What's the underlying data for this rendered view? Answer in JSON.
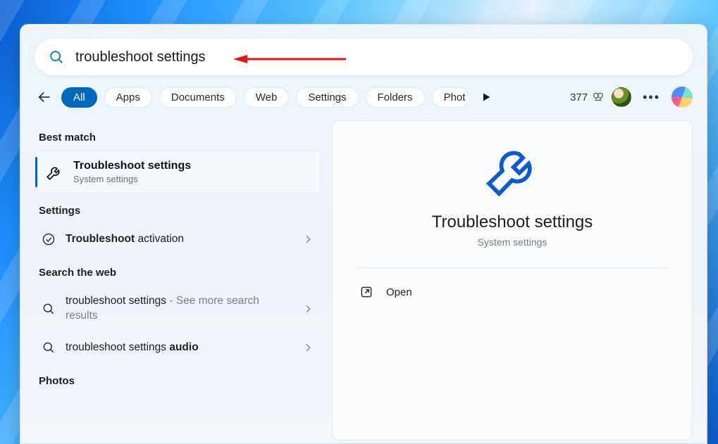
{
  "search": {
    "value": "troubleshoot settings"
  },
  "points": {
    "value": "377"
  },
  "tabs": {
    "all": "All",
    "apps": "Apps",
    "documents": "Documents",
    "web": "Web",
    "settings": "Settings",
    "folders": "Folders",
    "photos_cut": "Phot"
  },
  "sections": {
    "best_match": "Best match",
    "settings": "Settings",
    "search_web": "Search the web",
    "photos": "Photos"
  },
  "bestmatch": {
    "title": "Troubleshoot settings",
    "subtitle": "System settings"
  },
  "setting1": {
    "bold": "Troubleshoot",
    "rest": " activation"
  },
  "web1": {
    "main": "troubleshoot settings",
    "dash": " - ",
    "sub": "See more search results"
  },
  "web2": {
    "pre": "troubleshoot settings ",
    "bold": "audio"
  },
  "detail": {
    "title": "Troubleshoot settings",
    "subtitle": "System settings",
    "open_label": "Open"
  }
}
